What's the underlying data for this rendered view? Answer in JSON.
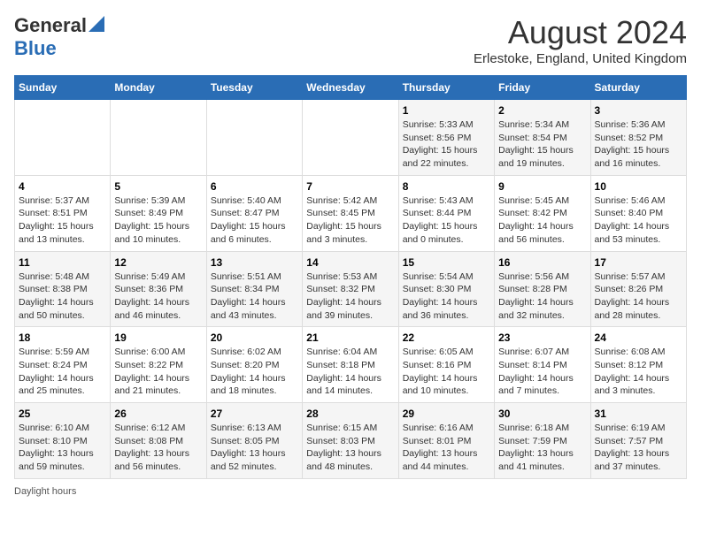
{
  "header": {
    "logo_general": "General",
    "logo_blue": "Blue",
    "month_title": "August 2024",
    "location": "Erlestoke, England, United Kingdom"
  },
  "days_of_week": [
    "Sunday",
    "Monday",
    "Tuesday",
    "Wednesday",
    "Thursday",
    "Friday",
    "Saturday"
  ],
  "footer": {
    "daylight_label": "Daylight hours"
  },
  "weeks": [
    [
      {
        "day": "",
        "info": ""
      },
      {
        "day": "",
        "info": ""
      },
      {
        "day": "",
        "info": ""
      },
      {
        "day": "",
        "info": ""
      },
      {
        "day": "1",
        "info": "Sunrise: 5:33 AM\nSunset: 8:56 PM\nDaylight: 15 hours\nand 22 minutes."
      },
      {
        "day": "2",
        "info": "Sunrise: 5:34 AM\nSunset: 8:54 PM\nDaylight: 15 hours\nand 19 minutes."
      },
      {
        "day": "3",
        "info": "Sunrise: 5:36 AM\nSunset: 8:52 PM\nDaylight: 15 hours\nand 16 minutes."
      }
    ],
    [
      {
        "day": "4",
        "info": "Sunrise: 5:37 AM\nSunset: 8:51 PM\nDaylight: 15 hours\nand 13 minutes."
      },
      {
        "day": "5",
        "info": "Sunrise: 5:39 AM\nSunset: 8:49 PM\nDaylight: 15 hours\nand 10 minutes."
      },
      {
        "day": "6",
        "info": "Sunrise: 5:40 AM\nSunset: 8:47 PM\nDaylight: 15 hours\nand 6 minutes."
      },
      {
        "day": "7",
        "info": "Sunrise: 5:42 AM\nSunset: 8:45 PM\nDaylight: 15 hours\nand 3 minutes."
      },
      {
        "day": "8",
        "info": "Sunrise: 5:43 AM\nSunset: 8:44 PM\nDaylight: 15 hours\nand 0 minutes."
      },
      {
        "day": "9",
        "info": "Sunrise: 5:45 AM\nSunset: 8:42 PM\nDaylight: 14 hours\nand 56 minutes."
      },
      {
        "day": "10",
        "info": "Sunrise: 5:46 AM\nSunset: 8:40 PM\nDaylight: 14 hours\nand 53 minutes."
      }
    ],
    [
      {
        "day": "11",
        "info": "Sunrise: 5:48 AM\nSunset: 8:38 PM\nDaylight: 14 hours\nand 50 minutes."
      },
      {
        "day": "12",
        "info": "Sunrise: 5:49 AM\nSunset: 8:36 PM\nDaylight: 14 hours\nand 46 minutes."
      },
      {
        "day": "13",
        "info": "Sunrise: 5:51 AM\nSunset: 8:34 PM\nDaylight: 14 hours\nand 43 minutes."
      },
      {
        "day": "14",
        "info": "Sunrise: 5:53 AM\nSunset: 8:32 PM\nDaylight: 14 hours\nand 39 minutes."
      },
      {
        "day": "15",
        "info": "Sunrise: 5:54 AM\nSunset: 8:30 PM\nDaylight: 14 hours\nand 36 minutes."
      },
      {
        "day": "16",
        "info": "Sunrise: 5:56 AM\nSunset: 8:28 PM\nDaylight: 14 hours\nand 32 minutes."
      },
      {
        "day": "17",
        "info": "Sunrise: 5:57 AM\nSunset: 8:26 PM\nDaylight: 14 hours\nand 28 minutes."
      }
    ],
    [
      {
        "day": "18",
        "info": "Sunrise: 5:59 AM\nSunset: 8:24 PM\nDaylight: 14 hours\nand 25 minutes."
      },
      {
        "day": "19",
        "info": "Sunrise: 6:00 AM\nSunset: 8:22 PM\nDaylight: 14 hours\nand 21 minutes."
      },
      {
        "day": "20",
        "info": "Sunrise: 6:02 AM\nSunset: 8:20 PM\nDaylight: 14 hours\nand 18 minutes."
      },
      {
        "day": "21",
        "info": "Sunrise: 6:04 AM\nSunset: 8:18 PM\nDaylight: 14 hours\nand 14 minutes."
      },
      {
        "day": "22",
        "info": "Sunrise: 6:05 AM\nSunset: 8:16 PM\nDaylight: 14 hours\nand 10 minutes."
      },
      {
        "day": "23",
        "info": "Sunrise: 6:07 AM\nSunset: 8:14 PM\nDaylight: 14 hours\nand 7 minutes."
      },
      {
        "day": "24",
        "info": "Sunrise: 6:08 AM\nSunset: 8:12 PM\nDaylight: 14 hours\nand 3 minutes."
      }
    ],
    [
      {
        "day": "25",
        "info": "Sunrise: 6:10 AM\nSunset: 8:10 PM\nDaylight: 13 hours\nand 59 minutes."
      },
      {
        "day": "26",
        "info": "Sunrise: 6:12 AM\nSunset: 8:08 PM\nDaylight: 13 hours\nand 56 minutes."
      },
      {
        "day": "27",
        "info": "Sunrise: 6:13 AM\nSunset: 8:05 PM\nDaylight: 13 hours\nand 52 minutes."
      },
      {
        "day": "28",
        "info": "Sunrise: 6:15 AM\nSunset: 8:03 PM\nDaylight: 13 hours\nand 48 minutes."
      },
      {
        "day": "29",
        "info": "Sunrise: 6:16 AM\nSunset: 8:01 PM\nDaylight: 13 hours\nand 44 minutes."
      },
      {
        "day": "30",
        "info": "Sunrise: 6:18 AM\nSunset: 7:59 PM\nDaylight: 13 hours\nand 41 minutes."
      },
      {
        "day": "31",
        "info": "Sunrise: 6:19 AM\nSunset: 7:57 PM\nDaylight: 13 hours\nand 37 minutes."
      }
    ]
  ]
}
